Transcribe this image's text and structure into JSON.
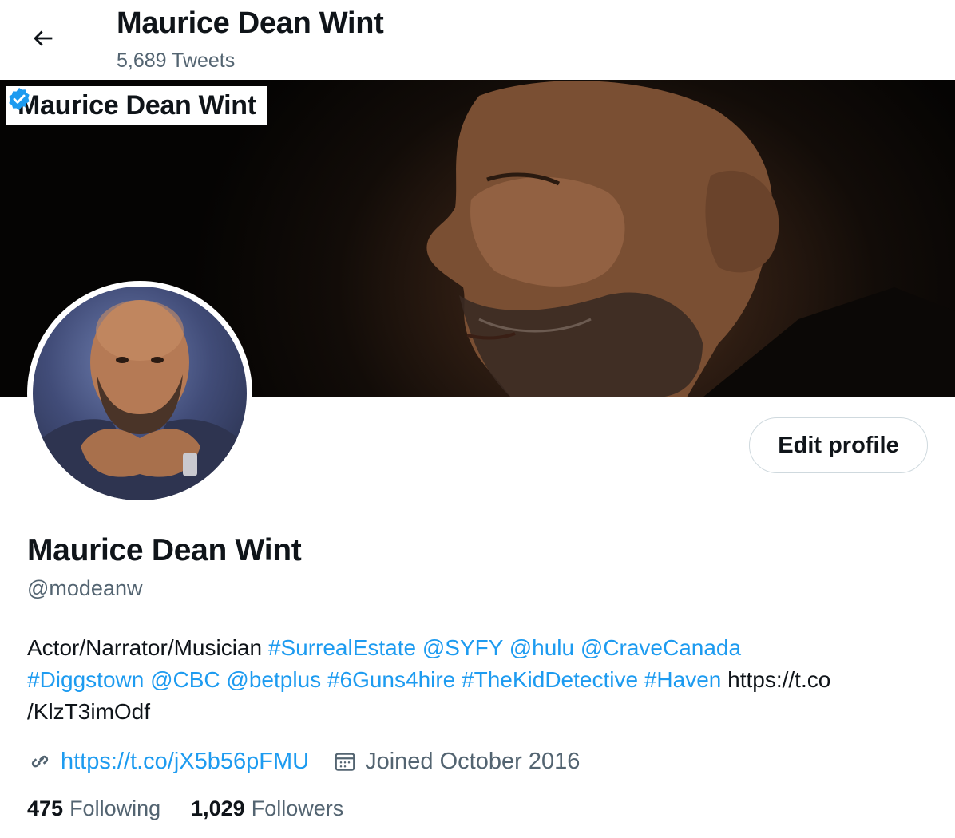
{
  "header": {
    "title": "Maurice Dean Wint",
    "tweet_count": "5,689 Tweets"
  },
  "banner": {
    "label": "Maurice Dean Wint",
    "verified_badge_color": "#1d9bf0"
  },
  "profile": {
    "edit_button": "Edit profile",
    "display_name": "Maurice Dean Wint",
    "handle": "@modeanw",
    "bio": {
      "t1": "Actor/Narrator/Musician ",
      "l1": "#SurrealEstate",
      "l2": "@SYFY",
      "l3": "@hulu",
      "l4": "@CraveCanada",
      "l5": "#Diggstown",
      "l6": "@CBC",
      "l7": "@betplus",
      "l8": "#6Guns4hire",
      "l9": "#TheKidDetective",
      "l10": "#Haven",
      "t2": " https://t.co",
      "t3": "/KlzT3imOdf"
    },
    "website": "https://t.co/jX5b56pFMU",
    "joined": "Joined October 2016",
    "following_count": "475",
    "following_label": "Following",
    "followers_count": "1,029",
    "followers_label": "Followers"
  },
  "icons": {
    "back": "arrow-left-icon",
    "link": "link-icon",
    "calendar": "calendar-icon",
    "verified": "verified-badge-icon"
  },
  "colors": {
    "accent": "#1d9bf0",
    "secondary_text": "#536471",
    "primary_text": "#0f1419"
  }
}
